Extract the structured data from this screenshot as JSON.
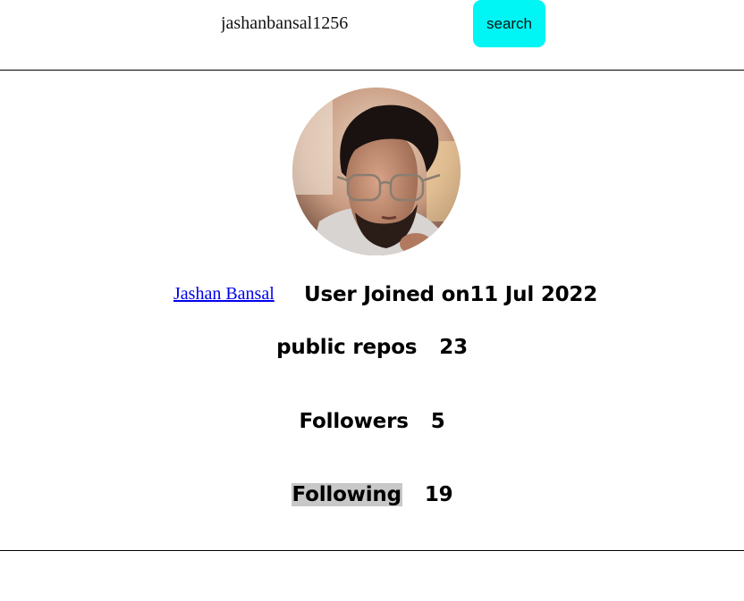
{
  "search": {
    "value": "jashanbansal1256",
    "button_label": "search",
    "button_color": "#00f5f5"
  },
  "profile": {
    "avatar_icon": "user-avatar-photo",
    "name_link": "Jashan Bansal",
    "joined_text": "User Joined on11 Jul 2022"
  },
  "stats": {
    "repos_label": "public repos",
    "repos_value": "23",
    "followers_label": "Followers",
    "followers_value": "5",
    "following_label": "Following",
    "following_value": "19"
  }
}
